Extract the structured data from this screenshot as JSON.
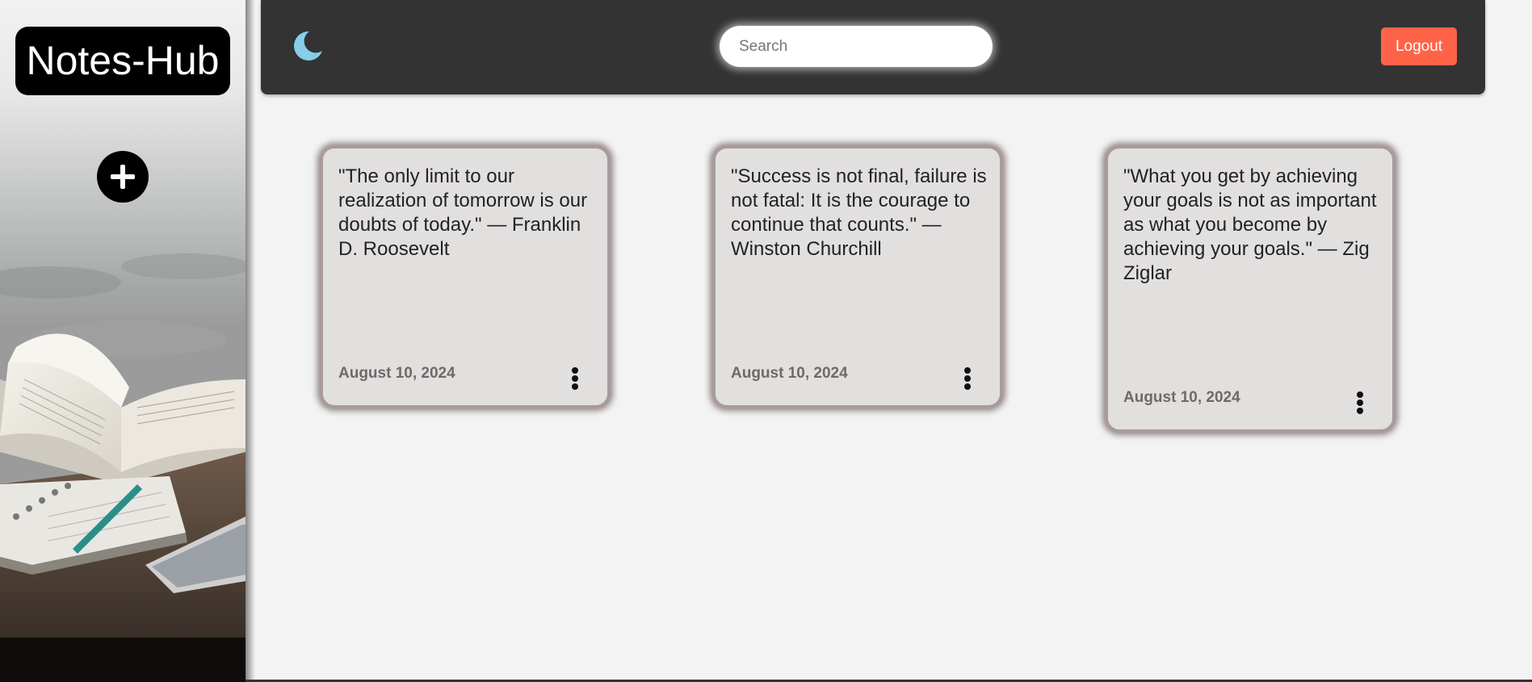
{
  "sidebar": {
    "brand": "Notes-Hub",
    "add_icon": "plus-icon"
  },
  "header": {
    "theme_icon": "moon-icon",
    "search": {
      "placeholder": "Search",
      "value": ""
    },
    "logout_label": "Logout"
  },
  "colors": {
    "header_bg": "#333333",
    "logout_bg": "#ff6347",
    "note_bg": "#e2dfdf",
    "note_border": "#aa9a9a",
    "moon": "#87ceeb"
  },
  "notes": [
    {
      "text": "\"The only limit to our realization of tomorrow is our doubts of today.\" — Franklin D. Roosevelt",
      "date": "August 10, 2024",
      "menu_icon": "more-vertical-icon"
    },
    {
      "text": "\"Success is not final, failure is not fatal: It is the courage to continue that counts.\" — Winston Churchill",
      "date": "August 10, 2024",
      "menu_icon": "more-vertical-icon"
    },
    {
      "text": "\"What you get by achieving your goals is not as important as what you become by achieving your goals.\" — Zig Ziglar",
      "date": "August 10, 2024",
      "menu_icon": "more-vertical-icon"
    }
  ]
}
